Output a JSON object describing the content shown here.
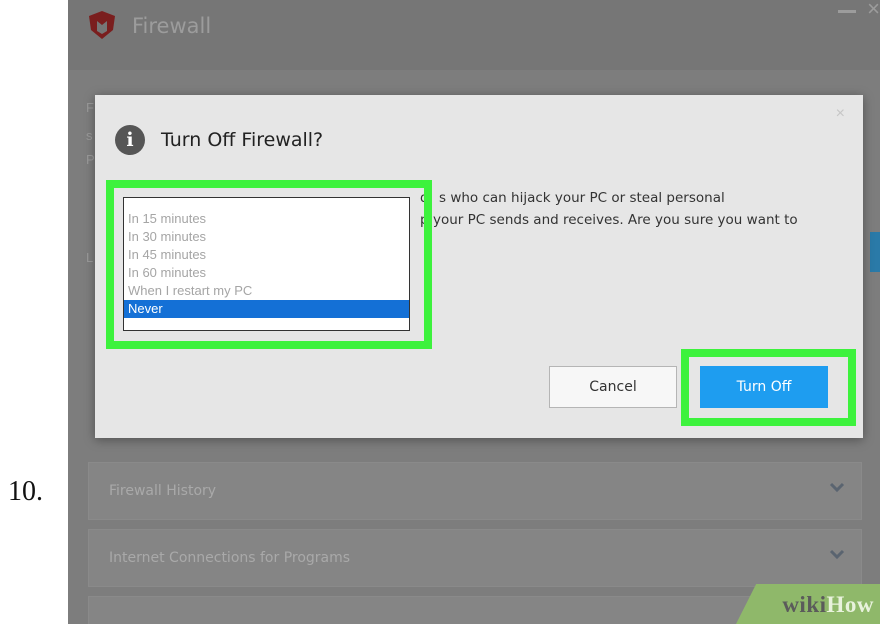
{
  "step": {
    "number": "10."
  },
  "app": {
    "title": "Firewall"
  },
  "background_sections": [
    {
      "label": "Firewall History"
    },
    {
      "label": "Internet Connections for Programs"
    }
  ],
  "dialog": {
    "title": "Turn Off Firewall?",
    "body_line1": "s who can hijack your PC or steal personal",
    "body_line2": "your PC sends and receives. Are you sure you want to",
    "fragment1": "d",
    "fragment2": "p",
    "cancel_label": "Cancel",
    "turn_off_label": "Turn Off"
  },
  "dropdown": {
    "options": [
      "In 15 minutes",
      "In 30 minutes",
      "In 45 minutes",
      "In 60 minutes",
      "When I restart my PC",
      "Never"
    ],
    "selected": "Never"
  },
  "watermark": {
    "wiki": "wiki",
    "how": "How"
  },
  "colors": {
    "highlight": "#3df23d",
    "primary_button": "#1e9df0",
    "selected_option": "#1470d6"
  }
}
